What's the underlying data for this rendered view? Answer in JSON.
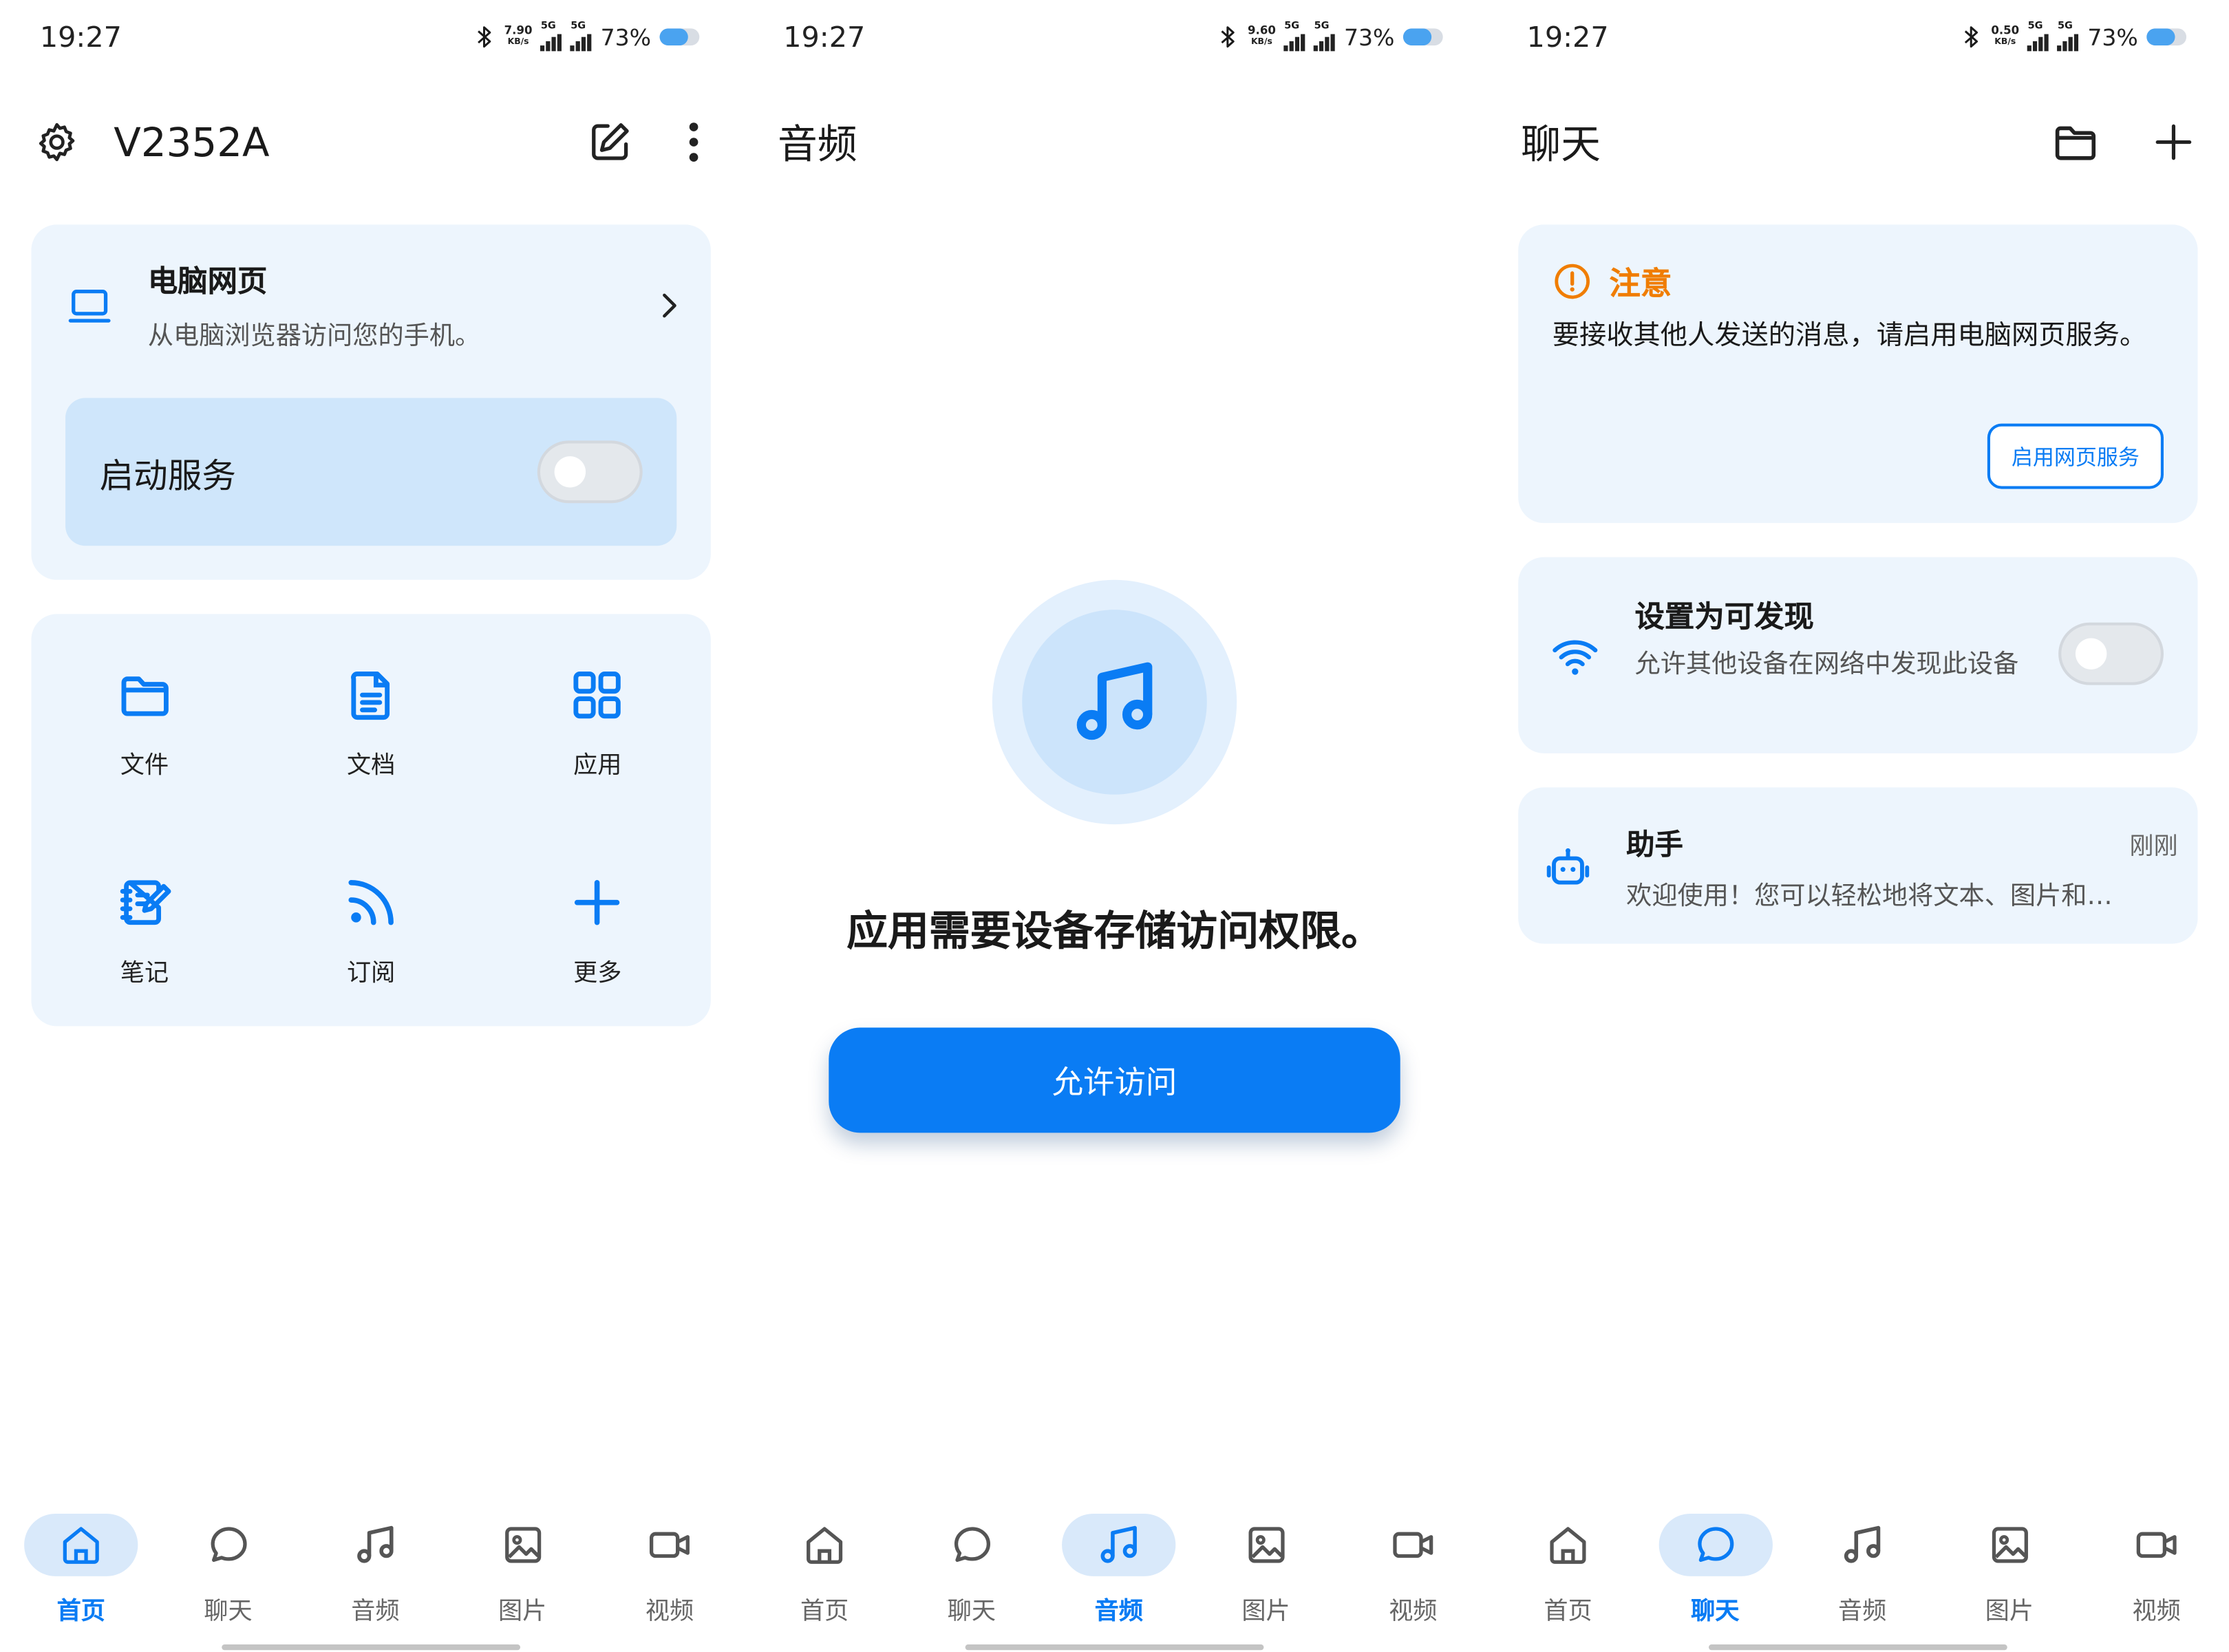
{
  "colors": {
    "accent": "#0a7cf4",
    "warning": "#f07d00",
    "card_bg": "#edf5fd"
  },
  "panels": [
    {
      "status": {
        "time": "19:27",
        "speed_value": "7.90",
        "speed_unit": "KB/s",
        "network": "5G",
        "battery": "73%",
        "battery_level": 0.73
      },
      "header": {
        "device_name": "V2352A"
      },
      "web_card": {
        "title": "电脑网页",
        "subtitle": "从电脑浏览器访问您的手机。"
      },
      "service": {
        "label": "启动服务",
        "enabled": false
      },
      "grid": [
        {
          "label": "文件",
          "icon": "folder-icon"
        },
        {
          "label": "文档",
          "icon": "document-icon"
        },
        {
          "label": "应用",
          "icon": "apps-grid-icon"
        },
        {
          "label": "笔记",
          "icon": "notebook-icon"
        },
        {
          "label": "订阅",
          "icon": "rss-icon"
        },
        {
          "label": "更多",
          "icon": "plus-icon"
        }
      ]
    },
    {
      "status": {
        "time": "19:27",
        "speed_value": "9.60",
        "speed_unit": "KB/s",
        "network": "5G",
        "battery": "73%",
        "battery_level": 0.73
      },
      "header": {
        "title": "音频"
      },
      "permission": {
        "message": "应用需要设备存储访问权限。",
        "button": "允许访问",
        "icon": "music-note-icon"
      }
    },
    {
      "status": {
        "time": "19:27",
        "speed_value": "0.50",
        "speed_unit": "KB/s",
        "network": "5G",
        "battery": "73%",
        "battery_level": 0.73
      },
      "header": {
        "title": "聊天"
      },
      "notice": {
        "title": "注意",
        "body": "要接收其他人发送的消息，请启用电脑网页服务。",
        "button": "启用网页服务"
      },
      "discoverable": {
        "title": "设置为可发现",
        "subtitle": "允许其他设备在网络中发现此设备",
        "enabled": false
      },
      "assistant": {
        "name": "助手",
        "time": "刚刚",
        "message": "欢迎使用！您可以轻松地将文本、图片和…"
      }
    }
  ],
  "nav": [
    "首页",
    "聊天",
    "音频",
    "图片",
    "视频"
  ],
  "active_tabs": [
    "首页",
    "音频",
    "聊天"
  ]
}
